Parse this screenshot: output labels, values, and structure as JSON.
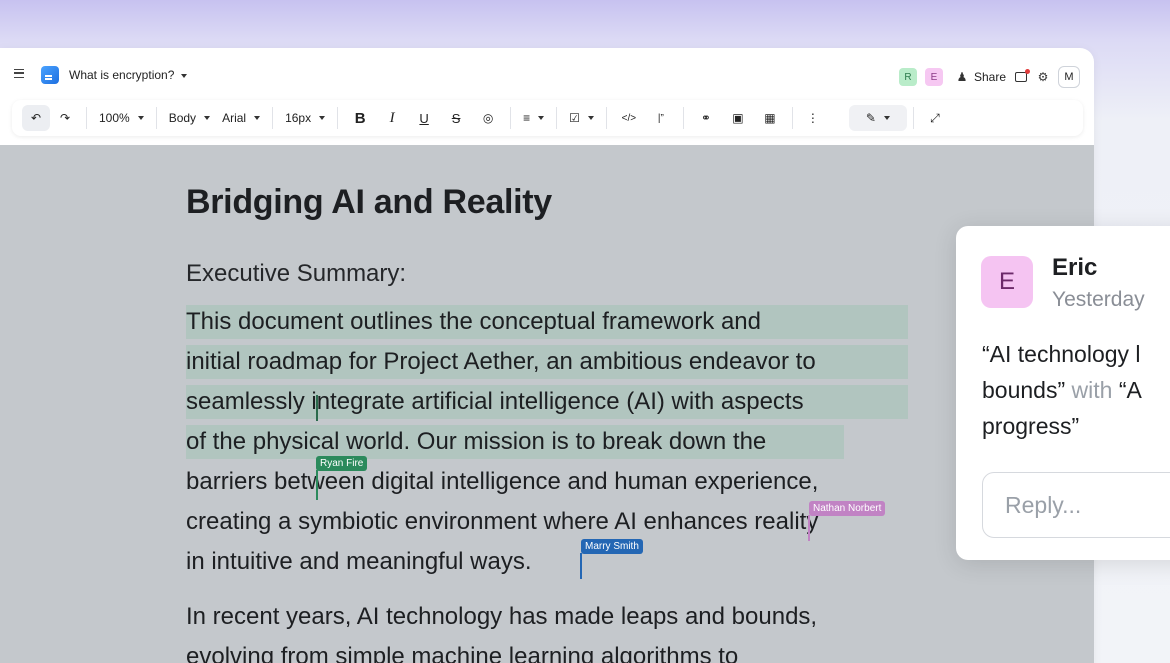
{
  "header": {
    "doc_title": "What is encryption?",
    "collaborators": [
      "R",
      "E"
    ],
    "share_label": "Share",
    "user_initial": "M"
  },
  "toolbar": {
    "zoom": "100%",
    "style": "Body",
    "font": "Arial",
    "size": "16px",
    "bold": "B",
    "italic": "I",
    "underline": "U",
    "strike": "S"
  },
  "document": {
    "title": "Bridging AI and Reality",
    "subtitle": "Executive Summary:",
    "paragraph1": [
      "This document outlines the conceptual framework and",
      "initial roadmap for Project Aether, an ambitious endeavor to",
      "seamlessly integrate artificial intelligence (AI) with aspects",
      "of the physical world. Our mission is to break down the",
      "barriers between digital intelligence and human experience,",
      "creating a symbiotic environment where AI enhances reality",
      "in intuitive and meaningful ways."
    ],
    "paragraph2": [
      "In recent years, AI technology has made leaps and bounds,",
      "evolving from simple machine learning algorithms to"
    ]
  },
  "cursors": [
    {
      "name": "Ryan Fire",
      "color": "#2b8a5c"
    },
    {
      "name": "Nathan Norbert",
      "color": "#c183c4"
    },
    {
      "name": "Marry Smith",
      "color": "#2467b4"
    }
  ],
  "comment": {
    "avatar": "E",
    "author": "Eric",
    "time": "Yesterday",
    "line1": "“AI technology l",
    "line2_a": "bounds”",
    "line2_b": " with ",
    "line2_c": "“A",
    "line3": "progress”",
    "reply_placeholder": "Reply..."
  },
  "icons": {
    "menu": "hamburger-icon",
    "doc": "document-icon",
    "share": "share-icon",
    "comments": "comment-icon",
    "settings": "gear-icon",
    "undo": "undo-icon",
    "redo": "redo-icon"
  }
}
